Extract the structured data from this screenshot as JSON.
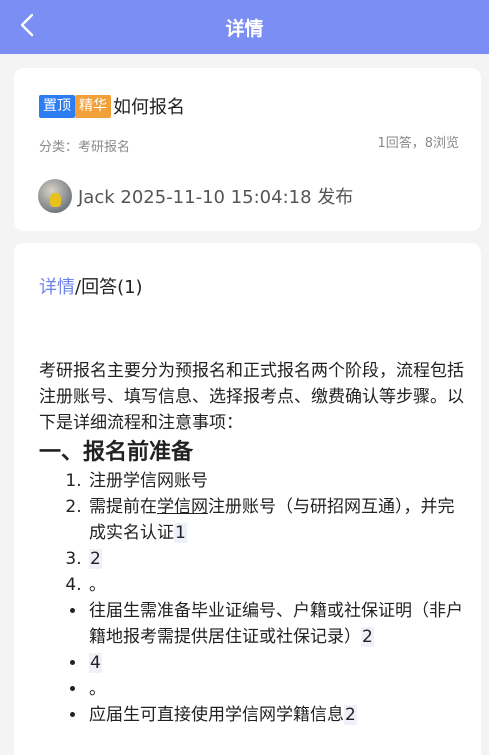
{
  "header": {
    "title": "详情",
    "back_icon": "back-arrow-icon"
  },
  "post": {
    "tag_top": "置顶",
    "tag_elite": "精华",
    "title": "如何报名",
    "category": "分类：考研报名",
    "stats": "1回答，8浏览",
    "author_line": "Jack 2025-11-10 15:04:18 发布"
  },
  "tabs": {
    "detail": "详情",
    "sep": "/",
    "answers": "回答(1)"
  },
  "article": {
    "intro": "考研报名主要分为预报名和正式报名两个阶段，流程包括注册账号、填写信息、选择报考点、缴费确认等步骤。以下是详细流程和注意事项：",
    "heading": "一、报名前准备",
    "ol": {
      "item1": "注册学信网账号",
      "item2_pre": "需提前在",
      "item2_link": "学信网",
      "item2_post": "注册账号（与研招网互通），并完成实名认证",
      "item2_ref": "1",
      "item3_ref": "2",
      "item4": "。"
    },
    "ul": {
      "item1": "往届生需准备毕业证编号、户籍或社保证明（非户籍地报考需提供居住证或社保记录）",
      "item1_ref": "2",
      "item2_ref": "4",
      "item3": "。",
      "item4": "应届生可直接使用学信网学籍信息",
      "item4_ref": "2"
    }
  },
  "colors": {
    "header_bg": "#7b8ef3",
    "tag_top": "#2e7cf1",
    "tag_elite": "#f2a13a",
    "tab_active": "#6b82ec"
  }
}
